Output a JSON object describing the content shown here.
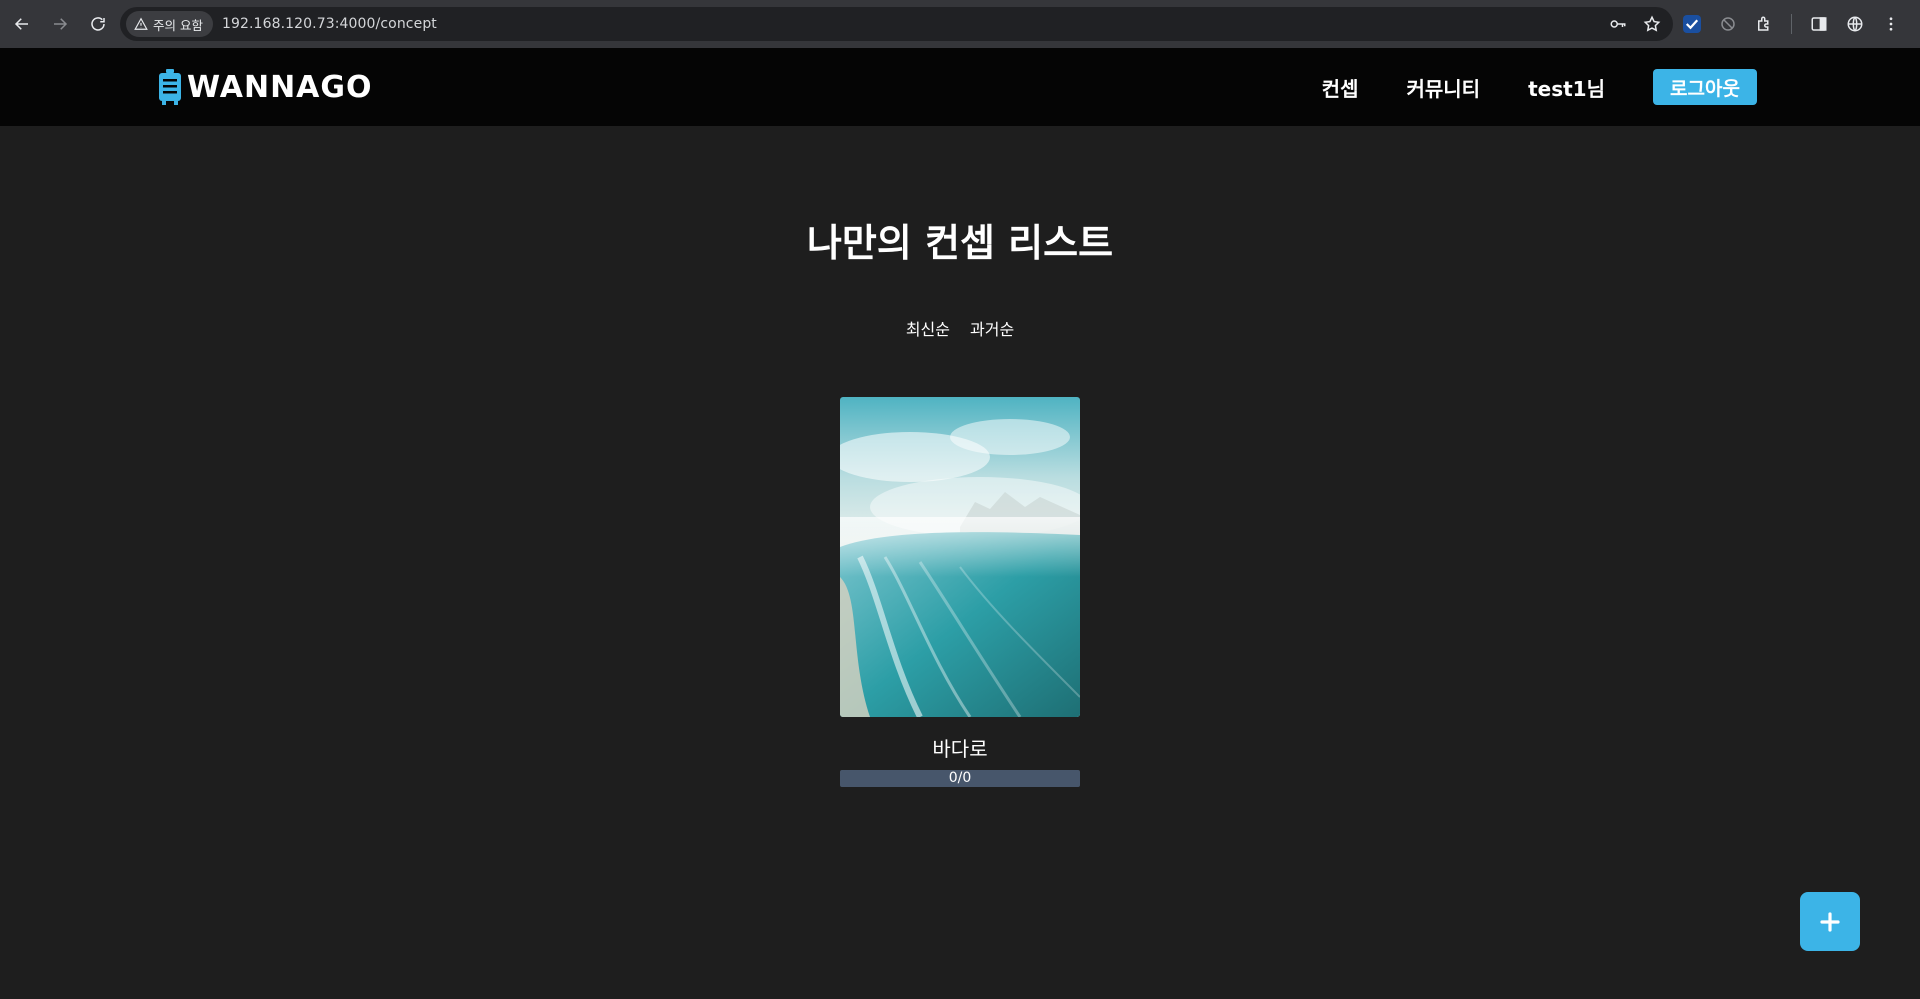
{
  "browser": {
    "security_chip": "주의 요함",
    "url": "192.168.120.73:4000/concept"
  },
  "site": {
    "logo_text": "WANNAGO",
    "nav": {
      "concept": "컨셉",
      "community": "커뮤니티",
      "user": "test1님",
      "logout": "로그아웃"
    }
  },
  "main": {
    "title": "나만의 컨셉 리스트",
    "sort_options": [
      "최신순",
      "과거순"
    ],
    "cards": [
      {
        "title": "바다로",
        "progress_text": "0/0",
        "progress_fraction": 0
      }
    ]
  },
  "colors": {
    "accent": "#3cb4e7",
    "page_bg": "#1e1e1e",
    "header_bg": "#050505",
    "progress_track": "#47566b"
  },
  "icons": {
    "fab": "plus-icon",
    "logo": "suitcase-icon"
  }
}
